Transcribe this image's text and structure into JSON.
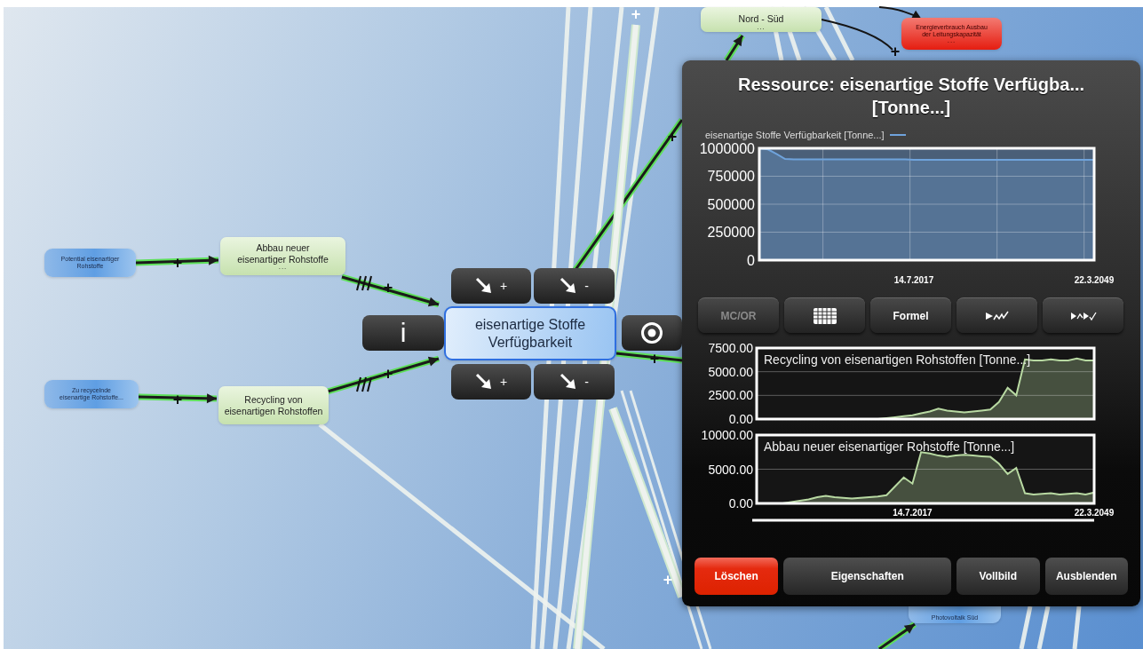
{
  "canvas": {
    "nodes": [
      {
        "kind": "source",
        "label": "Potential eisenartiger\nRohstoffe"
      },
      {
        "kind": "source",
        "label": "Zu recycelnde\neisenartige Rohstoffe..."
      },
      {
        "kind": "flow",
        "label": "Abbau neuer\neisenartiger Rohstoffe",
        "more": "..."
      },
      {
        "kind": "flow",
        "label": "Recycling von\neisenartigen Rohstoffen"
      },
      {
        "kind": "selected",
        "label": "eisenartige Stoffe\nVerfügbarkeit"
      },
      {
        "kind": "flow",
        "label": "Nord - Süd",
        "more": "..."
      },
      {
        "kind": "warning",
        "label": "Energieverbrauch Ausbau\nder Leitungskapazität",
        "more": "..."
      },
      {
        "kind": "source",
        "label": "Photovoltaik Süd"
      }
    ],
    "links": [
      {
        "kind": "active",
        "label": "+",
        "delay": false
      },
      {
        "kind": "active",
        "label": "+",
        "delay": false
      },
      {
        "kind": "active",
        "label": "+",
        "delay": true
      },
      {
        "kind": "active",
        "label": "+",
        "delay": true
      },
      {
        "kind": "active",
        "label": "+",
        "delay": false
      },
      {
        "kind": "active",
        "label": "+",
        "delay": false
      },
      {
        "kind": "plain",
        "label": "+",
        "delay": false
      },
      {
        "kind": "inactive",
        "label": "+",
        "delay": false
      },
      {
        "kind": "inactive",
        "label": "+",
        "delay": false
      },
      {
        "kind": "active",
        "delay": false
      },
      {
        "kind": "active",
        "delay": false
      },
      {
        "kind": "plain",
        "delay": false
      }
    ],
    "node_tools": [
      {
        "kind": "info",
        "label": "i"
      },
      {
        "kind": "arrow",
        "label": "+"
      },
      {
        "kind": "arrow",
        "label": "-"
      },
      {
        "kind": "arrow",
        "label": "+"
      },
      {
        "kind": "arrow",
        "label": "-"
      },
      {
        "kind": "target"
      }
    ]
  },
  "panel": {
    "title": "Ressource: eisenartige Stoffe Verfügba... [Tonne...]",
    "main_chart": {
      "chart_data": {
        "type": "area",
        "grid": true,
        "categories": [
          null,
          null,
          null,
          null,
          null,
          null,
          null,
          null,
          null,
          null,
          null,
          null,
          null,
          null,
          null,
          null,
          null,
          null,
          "14.7.2017",
          null,
          null,
          null,
          null,
          null,
          null,
          null,
          null,
          null,
          null,
          null,
          null,
          null,
          null,
          null,
          null,
          null,
          null,
          null,
          null,
          "22.3.2049"
        ],
        "ylim": [
          0,
          1000000
        ],
        "yticks": [
          0,
          250000,
          500000,
          750000,
          1000000
        ],
        "series": [
          {
            "name": "eisenartige Stoffe Verfügbarkeit [Tonne...]",
            "color": "#6fa3dc",
            "values": [
              1000000,
              990000,
              950000,
              905000,
              900000,
              900000,
              900000,
              900000,
              900000,
              900000,
              900000,
              900000,
              900000,
              900000,
              900000,
              900000,
              900000,
              900000,
              898000,
              897000,
              897000,
              897000,
              897000,
              897000,
              897000,
              897000,
              897000,
              897000,
              897000,
              897000,
              897000,
              897000,
              897000,
              897000,
              897000,
              897000,
              897000,
              897000,
              897000,
              897000
            ]
          }
        ]
      }
    },
    "toolbar": [
      {
        "kind": "text",
        "label": "MC/OR",
        "disabled": true
      },
      {
        "kind": "table"
      },
      {
        "kind": "text",
        "label": "Formel",
        "disabled": false
      },
      {
        "kind": "play-curve"
      },
      {
        "kind": "play-step"
      }
    ],
    "small_charts": [
      {
        "chart_data": {
          "type": "area",
          "grid": true,
          "ylim": [
            0,
            7500
          ],
          "yticks": [
            {
              "value": 0,
              "label": "0.00"
            },
            {
              "value": 2500,
              "label": "2500.00"
            },
            {
              "value": 5000,
              "label": "5000.00"
            },
            {
              "value": 7500,
              "label": "7500.00"
            }
          ],
          "series": [
            {
              "name": "Recycling von eisenartigen Rohstoffen [Tonne...]",
              "color": "#b8d9a2",
              "values": [
                0,
                0,
                0,
                0,
                0,
                0,
                0,
                0,
                0,
                0,
                0,
                0,
                0,
                0,
                0,
                100,
                200,
                300,
                400,
                600,
                800,
                1100,
                900,
                800,
                700,
                800,
                900,
                1000,
                1800,
                3300,
                2500,
                6300,
                6200,
                6200,
                6300,
                6200,
                6200,
                6400,
                6200,
                6200
              ]
            }
          ]
        }
      },
      {
        "chart_data": {
          "type": "area",
          "grid": true,
          "categories": [
            null,
            null,
            null,
            null,
            null,
            null,
            null,
            null,
            null,
            null,
            null,
            null,
            null,
            null,
            null,
            null,
            null,
            null,
            "14.7.2017",
            null,
            null,
            null,
            null,
            null,
            null,
            null,
            null,
            null,
            null,
            null,
            null,
            null,
            null,
            null,
            null,
            null,
            null,
            null,
            null,
            "22.3.2049"
          ],
          "ylim": [
            0,
            10000
          ],
          "yticks": [
            {
              "value": 0,
              "label": "0.00"
            },
            {
              "value": 5000,
              "label": "5000.00"
            },
            {
              "value": 10000,
              "label": "10000.00"
            }
          ],
          "series": [
            {
              "name": "Abbau neuer eisenartiger Rohstoffe [Tonne...]",
              "color": "#b8d9a2",
              "values": [
                0,
                0,
                0,
                0,
                200,
                400,
                600,
                900,
                1100,
                900,
                800,
                700,
                800,
                900,
                1000,
                1200,
                2500,
                3800,
                2900,
                7500,
                7300,
                7000,
                6800,
                7000,
                7100,
                7000,
                6900,
                6800,
                5800,
                4300,
                5200,
                1500,
                1300,
                1400,
                1500,
                1300,
                1400,
                1500,
                1300,
                1600
              ]
            }
          ]
        }
      }
    ],
    "buttons": [
      {
        "kind": "danger",
        "label": "Löschen"
      },
      {
        "kind": "normal",
        "label": "Eigenschaften"
      },
      {
        "kind": "normal",
        "label": "Vollbild"
      },
      {
        "kind": "normal",
        "label": "Ausblenden"
      }
    ]
  }
}
